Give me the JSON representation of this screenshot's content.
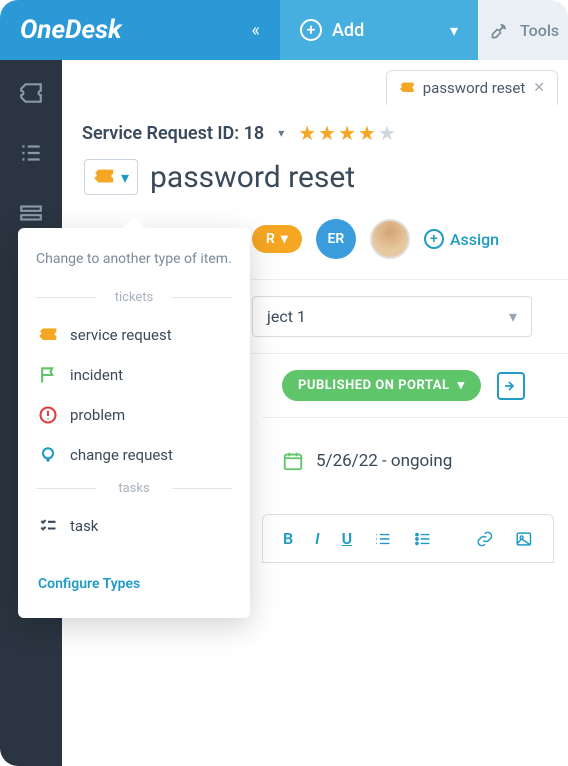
{
  "app": {
    "name": "OneDesk"
  },
  "topbar": {
    "add_label": "Add",
    "tools_label": "Tools"
  },
  "tab": {
    "title": "password reset"
  },
  "header": {
    "service_request_label": "Service Request ID: 18",
    "rating_filled": 4,
    "rating_total": 5
  },
  "item": {
    "title": "password reset",
    "requester_badge_label": "R",
    "assignee_initials": "ER",
    "assign_label": "Assign",
    "project": "ject 1",
    "portal_status": "PUBLISHED ON PORTAL",
    "date_range": "5/26/22 - ongoing"
  },
  "dropdown": {
    "description": "Change to another type of item.",
    "section_tickets": "tickets",
    "section_tasks": "tasks",
    "items_tickets": [
      {
        "label": "service request",
        "icon": "ticket-icon",
        "color": "#f5a623"
      },
      {
        "label": "incident",
        "icon": "flag-icon",
        "color": "#5fc56a"
      },
      {
        "label": "problem",
        "icon": "alert-icon",
        "color": "#e23b3b"
      },
      {
        "label": "change request",
        "icon": "bulb-icon",
        "color": "#1f9bc5"
      }
    ],
    "items_tasks": [
      {
        "label": "task",
        "icon": "checklist-icon",
        "color": "#3a4a5a"
      }
    ],
    "configure_label": "Configure Types"
  },
  "editor": {
    "bold": "B",
    "italic": "I",
    "underline": "U"
  }
}
